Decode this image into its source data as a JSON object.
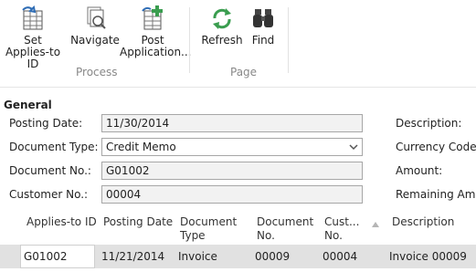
{
  "ribbon": {
    "buttons": [
      {
        "label_line1": "Set",
        "label_line2": "Applies-to ID",
        "icon": "set-applies-to-icon"
      },
      {
        "label_line1": "Navigate",
        "label_line2": "",
        "icon": "navigate-icon"
      },
      {
        "label_line1": "Post",
        "label_line2": "Application...",
        "icon": "post-application-icon"
      },
      {
        "label_line1": "Refresh",
        "label_line2": "",
        "icon": "refresh-icon"
      },
      {
        "label_line1": "Find",
        "label_line2": "",
        "icon": "find-icon"
      }
    ],
    "groups": [
      "Process",
      "Page"
    ]
  },
  "general": {
    "title": "General",
    "fields": [
      {
        "label": "Posting Date:",
        "value": "11/30/2014"
      },
      {
        "label": "Document Type:",
        "value": "Credit Memo"
      },
      {
        "label": "Document No.:",
        "value": "G01002"
      },
      {
        "label": "Customer No.:",
        "value": "00004"
      }
    ],
    "right_labels": [
      "Description:",
      "Currency Code:",
      "Amount:",
      "Remaining Amou"
    ]
  },
  "grid": {
    "headers": [
      {
        "line1": "Applies-to ID",
        "line2": ""
      },
      {
        "line1": "Posting Date",
        "line2": ""
      },
      {
        "line1": "Document",
        "line2": "Type"
      },
      {
        "line1": "Document",
        "line2": "No."
      },
      {
        "line1": "Cust...",
        "line2": "No."
      },
      {
        "line1": "Description",
        "line2": ""
      }
    ],
    "rows": [
      [
        "G01002",
        "11/21/2014",
        "Invoice",
        "00009",
        "00004",
        "Invoice 00009"
      ]
    ]
  },
  "colors": {
    "icon_blue": "#2f6db5",
    "icon_green": "#3a9d4f",
    "group_label": "#888888"
  }
}
